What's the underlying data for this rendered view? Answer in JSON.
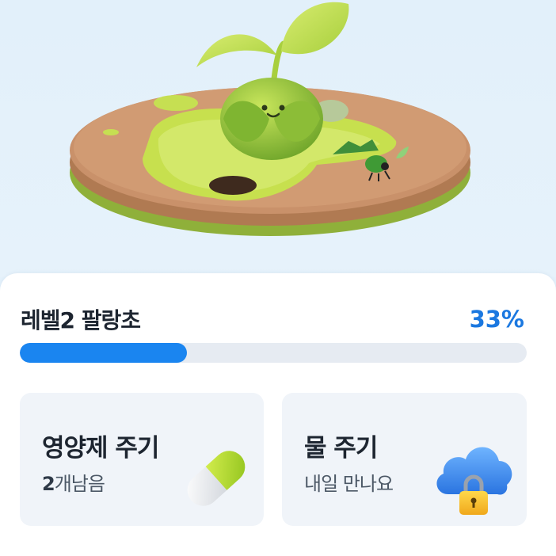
{
  "level": {
    "title": "레벨2 팔랑초",
    "percent_label": "33%",
    "progress": 0.33
  },
  "actions": [
    {
      "title": "영양제 주기",
      "count": "2",
      "subtitle": "개남음",
      "icon": "pill-icon"
    },
    {
      "title": "물 주기",
      "subtitle": "내일 만나요",
      "icon": "locked-cloud-icon"
    }
  ],
  "colors": {
    "accent": "#1a85f0",
    "background": "#e4f1fb",
    "tile": "#f0f4f9"
  }
}
